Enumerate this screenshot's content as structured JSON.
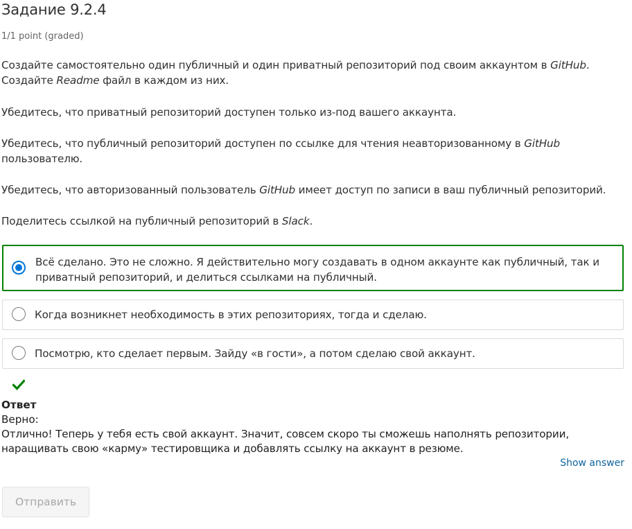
{
  "problem": {
    "title": "Задание 9.2.4",
    "points": "1/1 point (graded)"
  },
  "paragraphs": {
    "p1": {
      "a": "Создайте самостоятельно один публичный и один приватный репозиторий под своим аккаунтом в ",
      "b": "GitHub",
      "c": ". Создайте ",
      "d": "Readme",
      "e": " файл в каждом из них."
    },
    "p2": "Убедитесь, что приватный репозиторий доступен только из-под вашего аккаунта.",
    "p3": {
      "a": "Убедитесь, что публичный репозиторий доступен по ссылке для чтения неавторизованному в ",
      "b": "GitHub",
      "c": " пользователю."
    },
    "p4": {
      "a": "Убедитесь, что авторизованный пользователь ",
      "b": "GitHub",
      "c": " имеет доступ по записи в ваш публичный репозиторий."
    },
    "p5": {
      "a": "Поделитесь ссылкой на публичный репозиторий в ",
      "b": "Slack",
      "c": "."
    }
  },
  "choices": [
    {
      "label": "Всё сделано. Это не сложно. Я действительно могу создавать в одном аккаунте как публичный, так и приватный репозиторий, и делиться ссылками на публичный.",
      "selected": true
    },
    {
      "label": "Когда возникнет необходимость в этих репозиториях, тогда и сделаю.",
      "selected": false
    },
    {
      "label": "Посмотрю, кто сделает первым. Зайду «в гости», а потом сделаю свой аккаунт.",
      "selected": false
    }
  ],
  "feedback": {
    "status_icon": "checkmark-icon",
    "title": "Ответ",
    "verdict": "Верно:",
    "text": "Отлично! Теперь у тебя есть свой аккаунт. Значит, совсем скоро ты сможешь наполнять репозитории, наращивать свою «карму» тестировщика и добавлять ссылку на аккаунт в резюме."
  },
  "actions": {
    "show_answer": "Show answer",
    "submit": "Отправить"
  },
  "colors": {
    "correct": "#008100",
    "radio_selected": "#0075d8",
    "link": "#0e64a0"
  }
}
